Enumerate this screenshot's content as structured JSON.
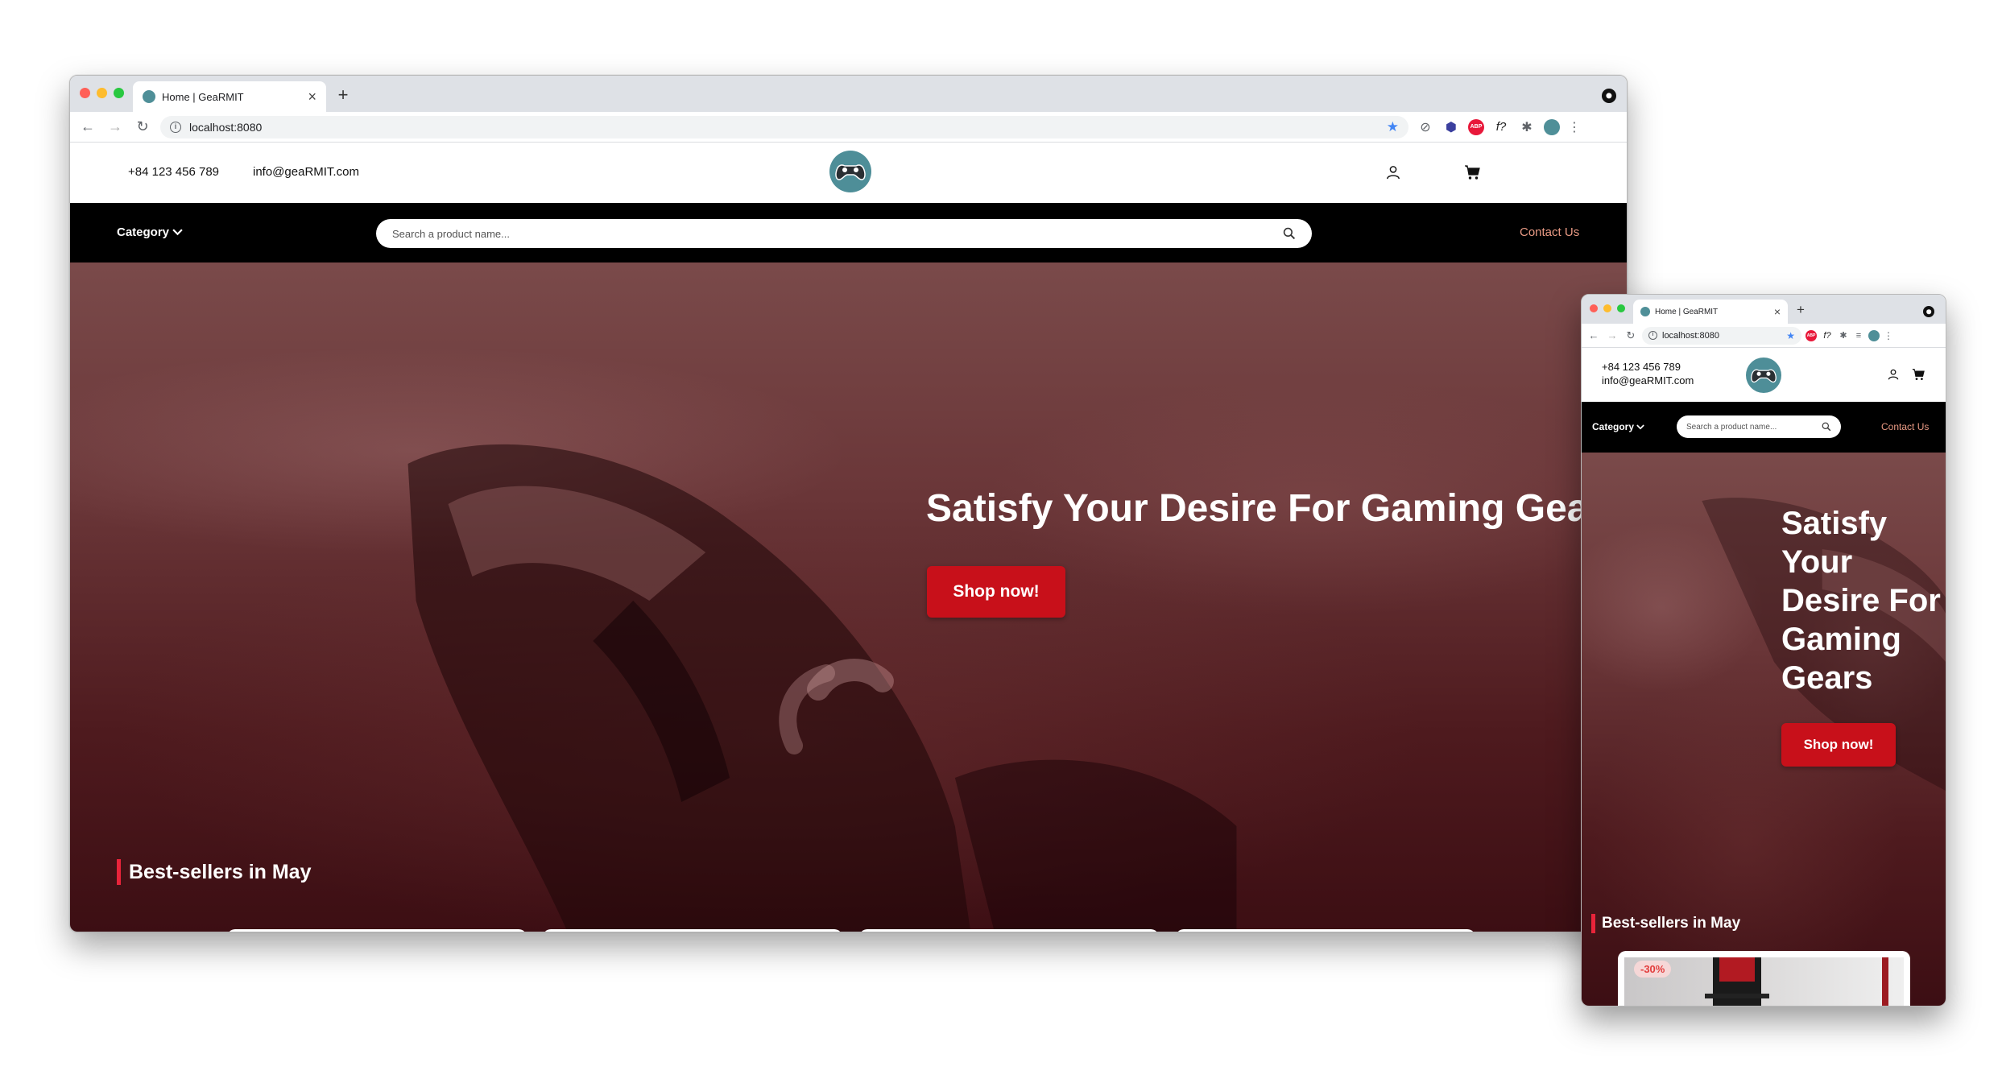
{
  "browser": {
    "tab_title": "Home | GeaRMIT",
    "tab_close": "×",
    "new_tab": "+",
    "url": "localhost:8080",
    "ext_abp": "ABP",
    "ext_formula": "f?"
  },
  "site": {
    "phone": "+84 123 456 789",
    "email": "info@geaRMIT.com",
    "category_label": "Category",
    "search_placeholder": "Search a product name...",
    "contact_us": "Contact Us",
    "hero_title": "Satisfy Your Desire For Gaming Gears",
    "shop_now": "Shop now!",
    "bestsellers_title": "Best-sellers in May",
    "first_product_badge": "-30%"
  },
  "colors": {
    "accent_red": "#c8101a",
    "contact_us": "#e99a84",
    "logo_teal": "#4e8e98"
  }
}
